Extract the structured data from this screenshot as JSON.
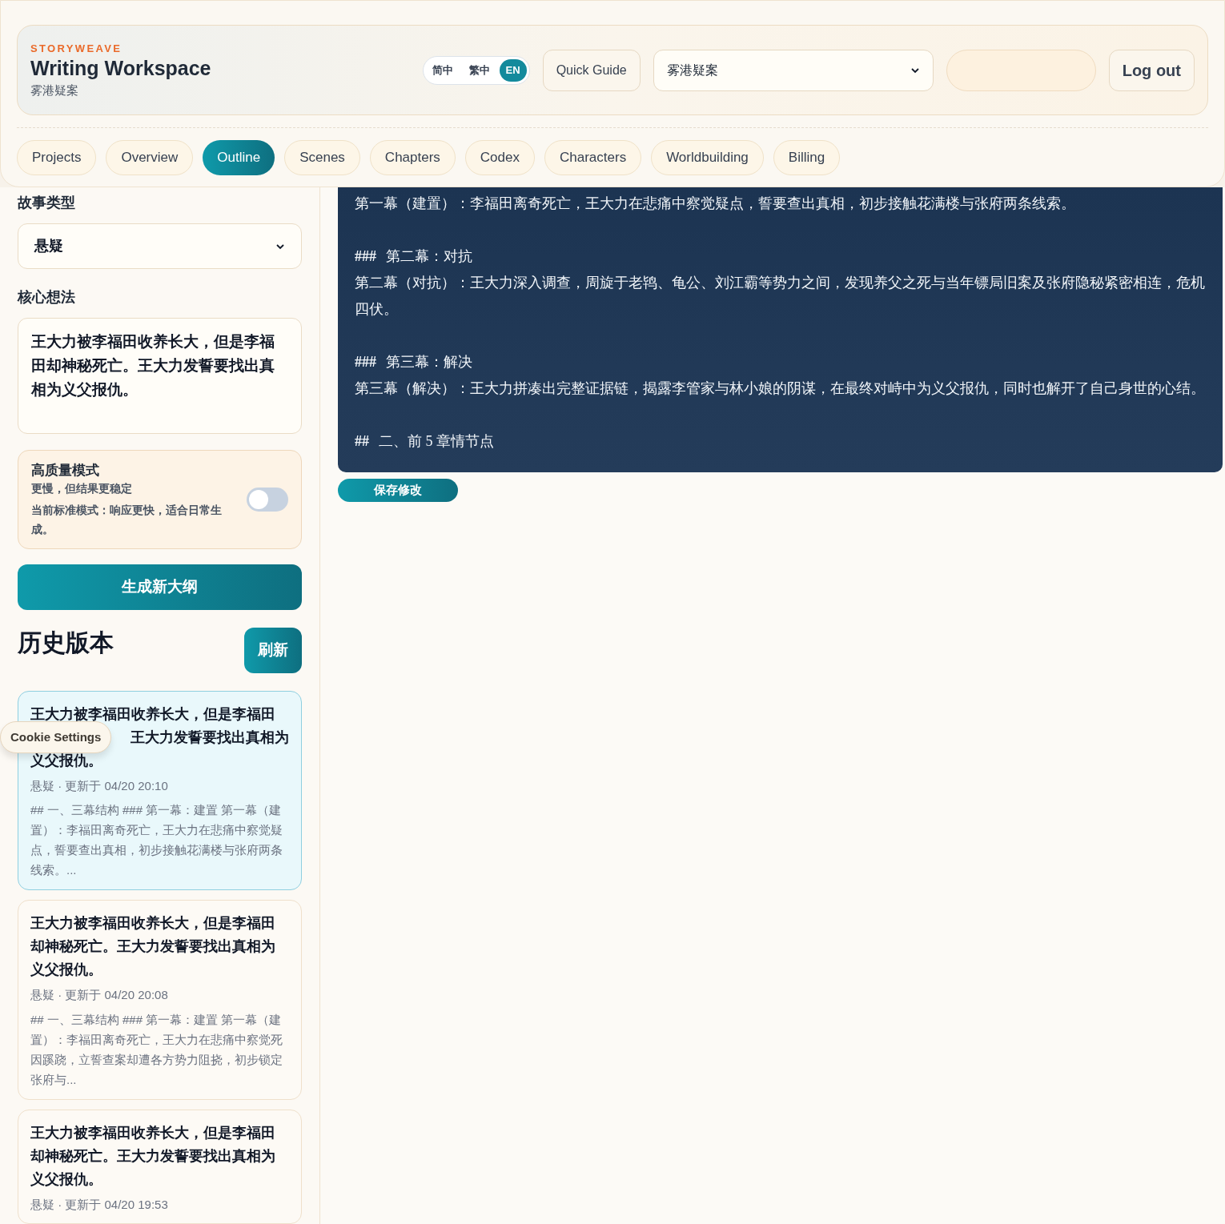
{
  "brand": "STORYWEAVE",
  "title": "Writing Workspace",
  "subtitle": "雾港疑案",
  "languages": [
    {
      "label": "简中",
      "selected": false
    },
    {
      "label": "繁中",
      "selected": false
    },
    {
      "label": "EN",
      "selected": true
    }
  ],
  "quick_guide": "Quick Guide",
  "project_select": {
    "value": "雾港疑案"
  },
  "logout": "Log out",
  "tabs": [
    {
      "label": "Projects",
      "selected": false
    },
    {
      "label": "Overview",
      "selected": false
    },
    {
      "label": "Outline",
      "selected": true
    },
    {
      "label": "Scenes",
      "selected": false
    },
    {
      "label": "Chapters",
      "selected": false
    },
    {
      "label": "Codex",
      "selected": false
    },
    {
      "label": "Characters",
      "selected": false
    },
    {
      "label": "Worldbuilding",
      "selected": false
    },
    {
      "label": "Billing",
      "selected": false
    }
  ],
  "sidebar": {
    "genre_label": "故事类型",
    "genre_value": "悬疑",
    "idea_label": "核心想法",
    "idea_value": "王大力被李福田收养长大，但是李福田却神秘死亡。王大力发誓要找出真相为义父报仇。",
    "quality": {
      "title": "高质量模式",
      "hint": "更慢，但结果更稳定",
      "status": "当前标准模式：响应更快，适合日常生成。",
      "on": false
    },
    "generate": "生成新大纲",
    "history_title": "历史版本",
    "refresh": "刷新",
    "history": [
      {
        "title_lines": [
          "王大力被李福田收养长大，但是李福田",
          "王大力发誓要找出真相为",
          "义父报仇。"
        ],
        "meta": "悬疑 · 更新于 04/20 20:10",
        "preview": "## 一、三幕结构 ### 第一幕：建置 第一幕（建置）：李福田离奇死亡，王大力在悲痛中察觉疑点，誓要查出真相，初步接触花满楼与张府两条线索。...",
        "selected": true
      },
      {
        "title": "王大力被李福田收养长大，但是李福田却神秘死亡。王大力发誓要找出真相为义父报仇。",
        "meta": "悬疑 · 更新于 04/20 20:08",
        "preview": "## 一、三幕结构 ### 第一幕：建置 第一幕（建置）：李福田离奇死亡，王大力在悲痛中察觉死因蹊跷，立誓查案却遭各方势力阻挠，初步锁定张府与...",
        "selected": false
      },
      {
        "title": "王大力被李福田收养长大，但是李福田却神秘死亡。王大力发誓要找出真相为义父报仇。",
        "meta": "悬疑 · 更新于 04/20 19:53",
        "selected": false
      }
    ]
  },
  "editor": {
    "lines": [
      {
        "kind": "text",
        "text": "第一幕（建置）：李福田离奇死亡，王大力在悲痛中察觉疑点，誓要查出真相，初步接触花满楼与张府两条线索。"
      },
      {
        "kind": "heading",
        "marker": "###",
        "text": "第二幕：对抗"
      },
      {
        "kind": "text",
        "text": "第二幕（对抗）：王大力深入调查，周旋于老鸨、龟公、刘江霸等势力之间，发现养父之死与当年镖局旧案及张府隐秘紧密相连，危机四伏。"
      },
      {
        "kind": "heading",
        "marker": "###",
        "text": "第三幕：解决"
      },
      {
        "kind": "text",
        "text": "第三幕（解决）：王大力拼凑出完整证据链，揭露李管家与林小娘的阴谋，在最终对峙中为义父报仇，同时也解开了自己身世的心结。"
      },
      {
        "kind": "heading",
        "marker": "##",
        "text": "二、前 5 章情节点"
      }
    ],
    "save": "保存修改"
  },
  "cookie_button": "Cookie Settings"
}
